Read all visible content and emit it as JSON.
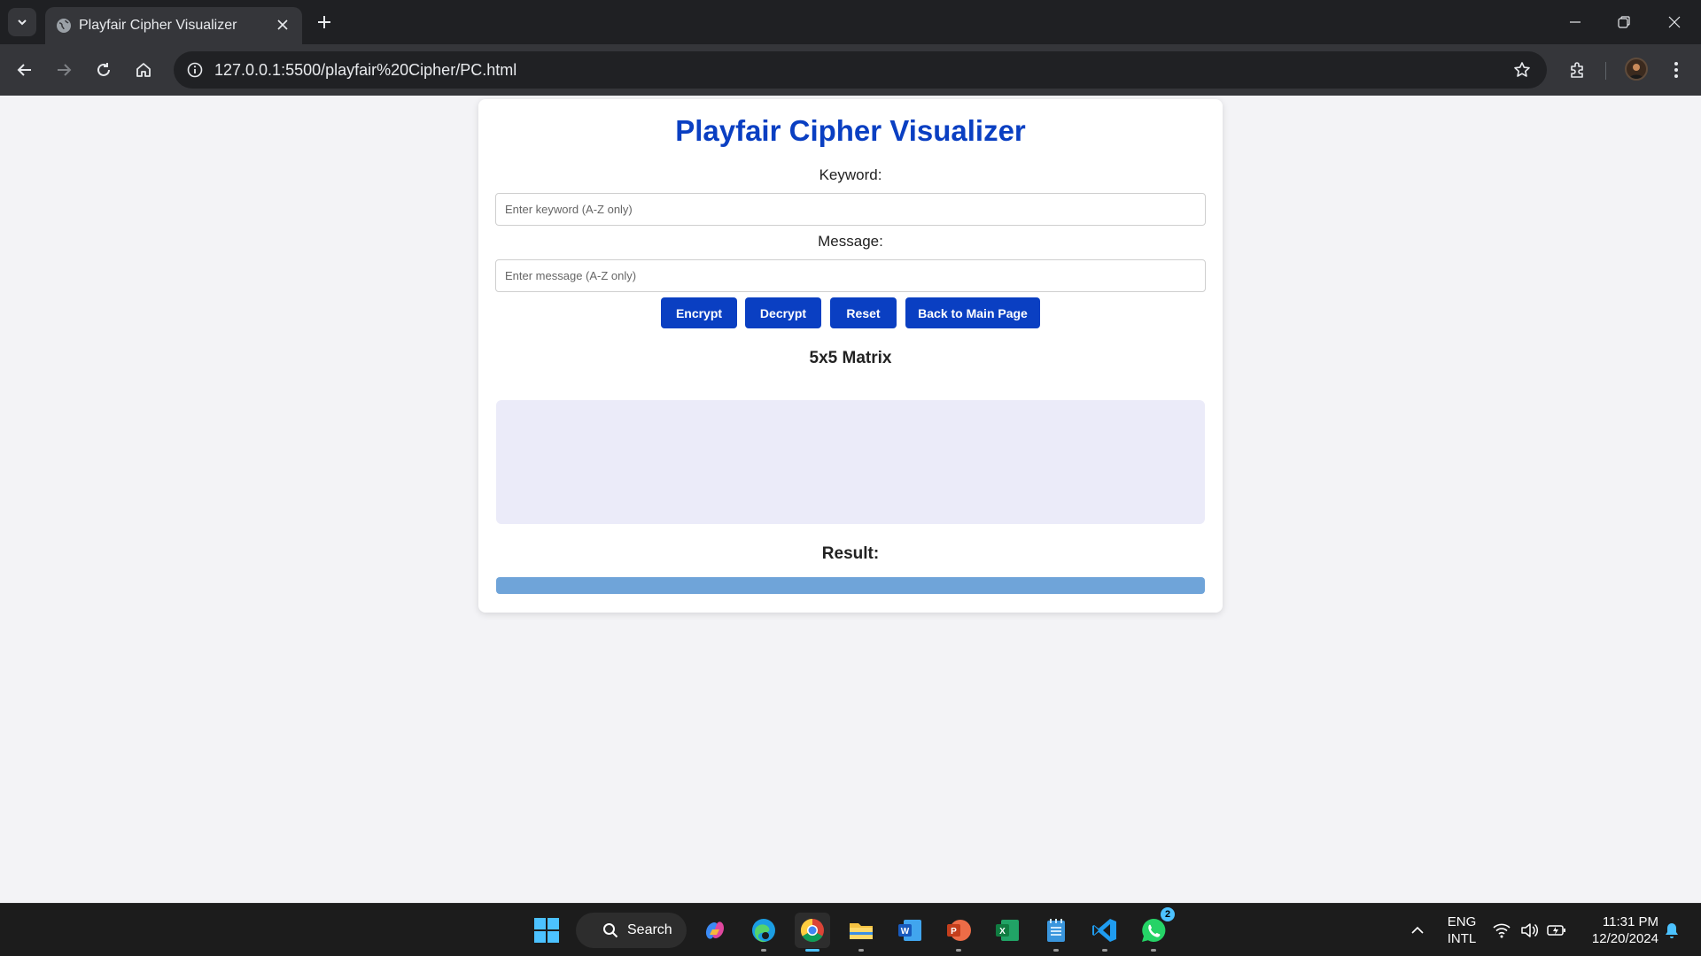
{
  "browser": {
    "tab": {
      "title": "Playfair Cipher Visualizer"
    },
    "url": "127.0.0.1:5500/playfair%20Cipher/PC.html"
  },
  "page": {
    "title": "Playfair Cipher Visualizer",
    "keyword": {
      "label": "Keyword:",
      "placeholder": "Enter keyword (A-Z only)",
      "value": ""
    },
    "message": {
      "label": "Message:",
      "placeholder": "Enter message (A-Z only)",
      "value": ""
    },
    "buttons": {
      "encrypt": "Encrypt",
      "decrypt": "Decrypt",
      "reset": "Reset",
      "back": "Back to Main Page"
    },
    "matrix_heading": "5x5 Matrix",
    "result_heading": "Result:",
    "result_value": ""
  },
  "taskbar": {
    "search_label": "Search",
    "language": {
      "line1": "ENG",
      "line2": "INTL"
    },
    "clock": {
      "time": "11:31 PM",
      "date": "12/20/2024"
    },
    "whatsapp_badge": "2"
  },
  "colors": {
    "accent": "#0a3fc2",
    "matrix_bg": "#ebebf9",
    "result_bar": "#6fa4d9"
  }
}
